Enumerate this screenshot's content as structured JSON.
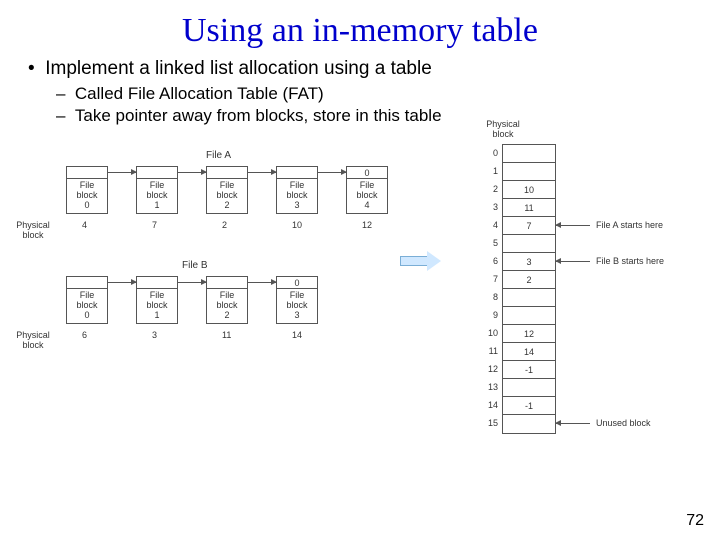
{
  "title": "Using an in-memory table",
  "bullet1": "Implement a linked list allocation using a table",
  "bullet2a": "Called File Allocation Table (FAT)",
  "bullet2b": "Take pointer away from blocks, store in this table",
  "labels": {
    "fileA": "File A",
    "fileB": "File B",
    "physBlock": "Physical\nblock",
    "fatHeader": "Physical\nblock",
    "fileAStart": "File A starts here",
    "fileBStart": "File B starts here",
    "unused": "Unused block",
    "fb": "File\nblock"
  },
  "fileA": {
    "ptr": [
      "",
      "",
      "",
      "",
      "0"
    ],
    "num": [
      "0",
      "1",
      "2",
      "3",
      "4"
    ],
    "pb": [
      "4",
      "7",
      "2",
      "10",
      "12"
    ]
  },
  "fileB": {
    "ptr": [
      "",
      "",
      "",
      "0"
    ],
    "num": [
      "0",
      "1",
      "2",
      "3"
    ],
    "pb": [
      "6",
      "3",
      "11",
      "14"
    ]
  },
  "fat": {
    "idx": [
      "0",
      "1",
      "2",
      "3",
      "4",
      "5",
      "6",
      "7",
      "8",
      "9",
      "10",
      "11",
      "12",
      "13",
      "14",
      "15"
    ],
    "val": [
      "",
      "",
      "10",
      "11",
      "7",
      "",
      "3",
      "2",
      "",
      "",
      "12",
      "14",
      "-1",
      "",
      "-1",
      ""
    ]
  },
  "page": "72"
}
